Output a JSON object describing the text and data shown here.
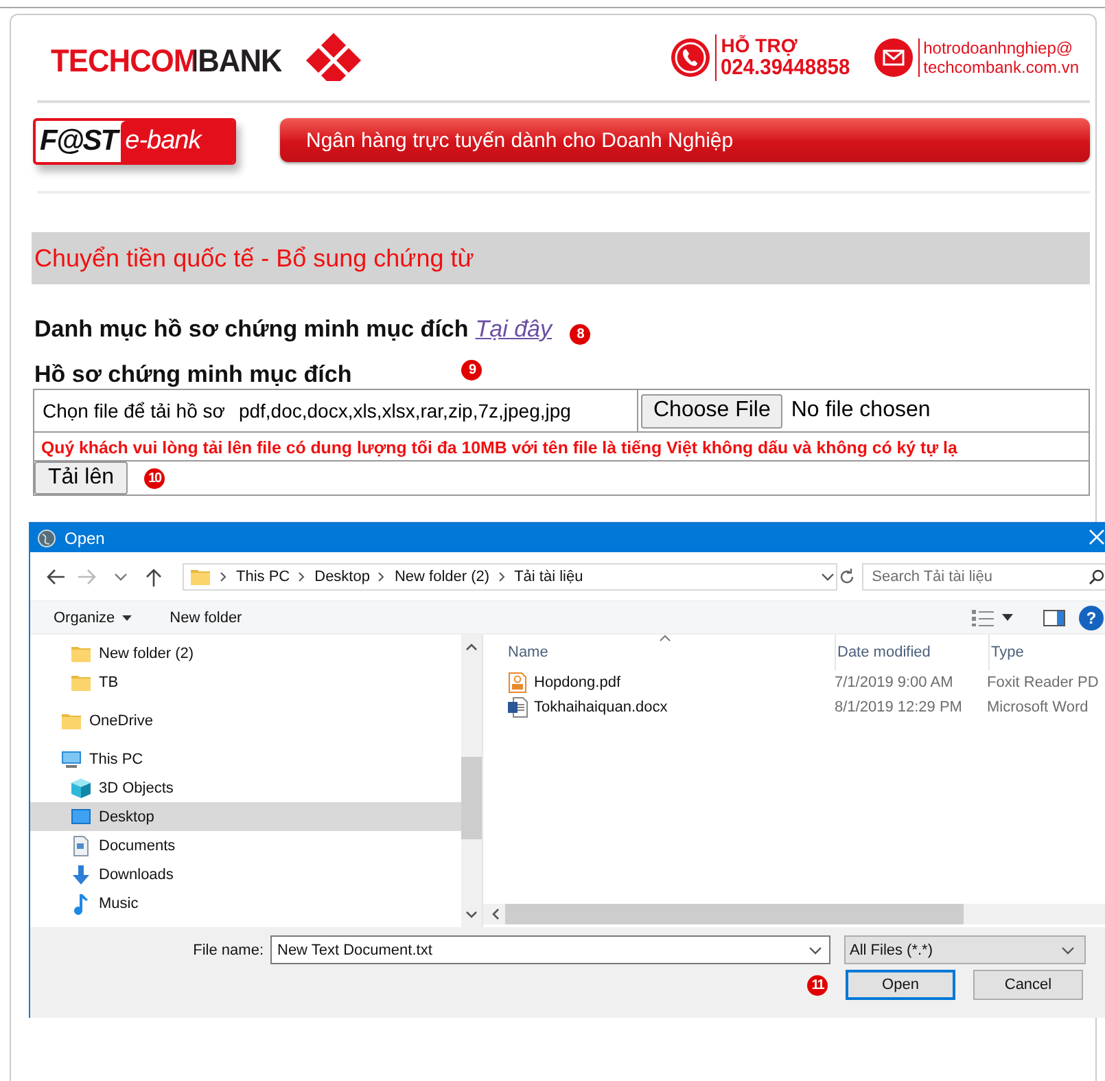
{
  "header": {
    "brand": "TECHCOMBANK",
    "support_label": "HỖ TRỢ",
    "support_phone": "024.39448858",
    "email_line_1": "hotrodoanhnghiep@",
    "email_line_2": "techcombank.com.vn",
    "logo_words": [
      "F@ST",
      "e-bank"
    ],
    "banner": "Ngân hàng trực tuyến dành cho Doanh Nghiệp"
  },
  "page_title": "Chuyển tiền quốc tế - Bổ sung chứng từ",
  "catalog": {
    "label": "Danh mục hồ sơ chứng minh mục đích",
    "link": "Tại đây",
    "marker": "8"
  },
  "documents": {
    "title": "Hồ sơ chứng minh mục đích",
    "marker": "9",
    "file_label": "Chọn file để tải hồ sơ",
    "formats": "pdf,doc,docx,xls,xlsx,rar,zip,7z,jpeg,jpg",
    "choose_button": "Choose File",
    "file_status": "No file chosen",
    "warning": "Quý khách vui lòng tải lên file có dung lượng tối đa 10MB với tên file là tiếng Việt không dấu và không có ký tự lạ",
    "upload_button": "Tải lên",
    "upload_marker": "10"
  },
  "dialog": {
    "title": "Open",
    "path": [
      "This PC",
      "Desktop",
      "New folder (2)",
      "Tải tài liệu"
    ],
    "search": {
      "placeholder": "Search Tải tài liệu"
    },
    "toolbar": [
      "Organize",
      "New folder"
    ],
    "help": "?",
    "nav": [
      {
        "children": [
          {
            "label": "New folder (2)",
            "kind": "folder",
            "selected": false
          },
          {
            "label": "TB",
            "kind": "folder",
            "selected": false
          }
        ]
      },
      {
        "label": "OneDrive",
        "kind": "folder",
        "selected": false
      },
      {
        "label": "This PC",
        "kind": "pc",
        "selected": false,
        "children": [
          {
            "label": "3D Objects",
            "kind": "cube",
            "selected": false
          },
          {
            "label": "Desktop",
            "kind": "desktop",
            "selected": true
          },
          {
            "label": "Documents",
            "kind": "documents",
            "selected": false
          },
          {
            "label": "Downloads",
            "kind": "downloads",
            "selected": false
          },
          {
            "label": "Music",
            "kind": "music",
            "selected": false
          }
        ]
      }
    ],
    "columns": [
      "Name",
      "Date modified",
      "Type"
    ],
    "files": [
      {
        "name": "Hopdong.pdf",
        "kind": "pdf",
        "date": "7/1/2019 9:00 AM",
        "type": "Foxit Reader PD",
        "selected": false
      },
      {
        "name": "Tokhaihaiquan.docx",
        "kind": "word",
        "date": "8/1/2019 12:29 PM",
        "type": "Microsoft Word",
        "selected": false
      }
    ],
    "file_name_label": "File name:",
    "file_name": "New Text Document.txt",
    "filter": "All Files (*.*)",
    "open_button": "Open",
    "cancel_button": "Cancel",
    "marker": "11"
  }
}
